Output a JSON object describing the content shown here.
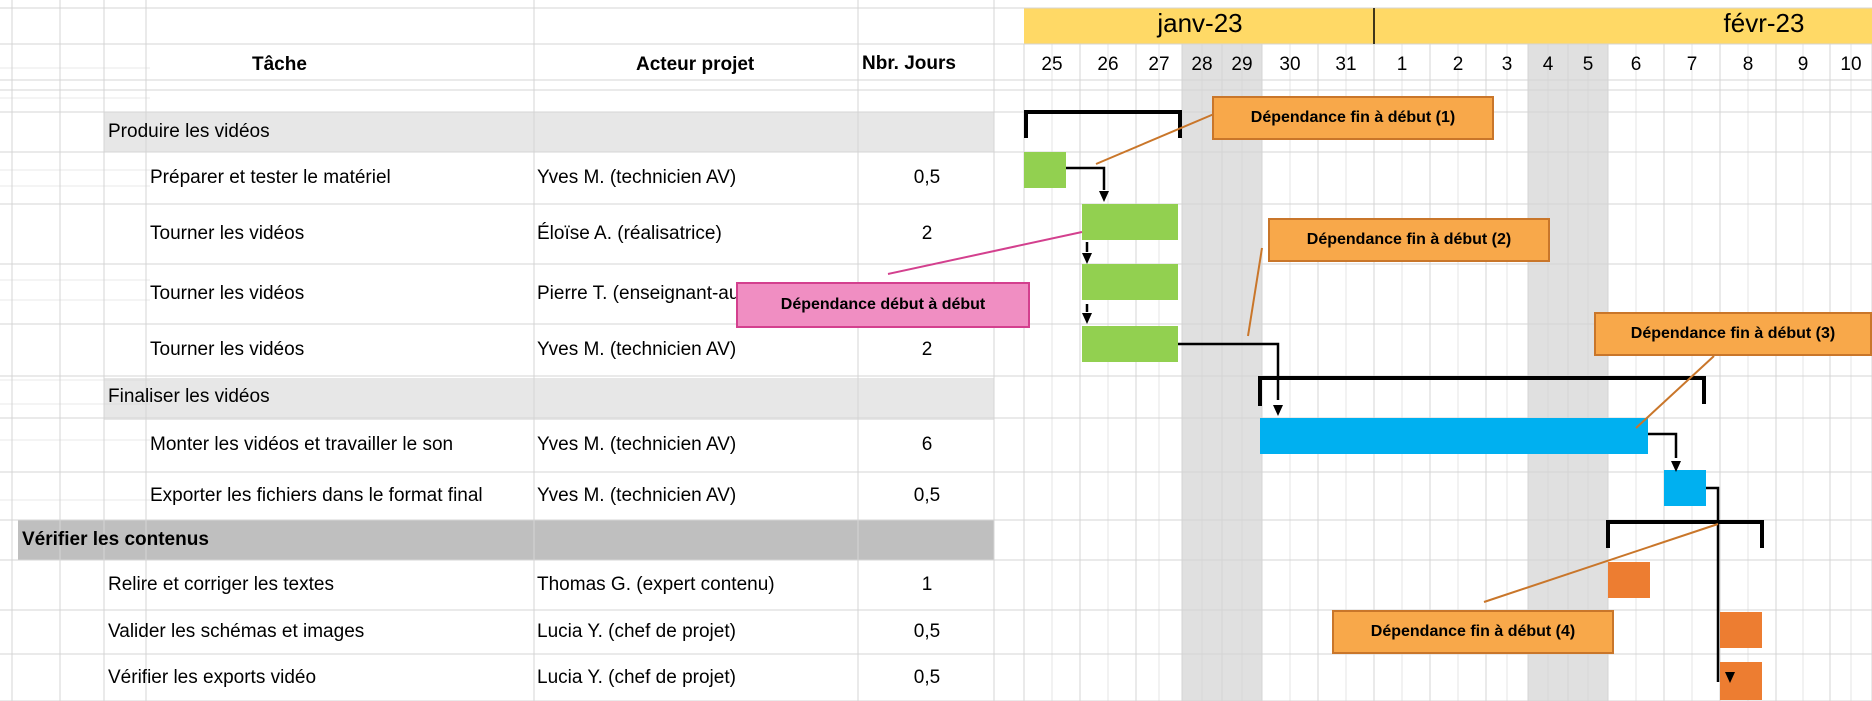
{
  "colors": {
    "month_header": "#ffd966",
    "group_band": "#e7e7e7",
    "section_band": "#bfbfbf",
    "weekend_shade": "#e0e0e0",
    "grid": "#d4d4d4",
    "green": "#92d050",
    "blue": "#00b0f0",
    "orange": "#ed7d31",
    "orange_callout": "#f8a84a",
    "pink_callout": "#f08ec2"
  },
  "columns": {
    "task": "Tâche",
    "actor": "Acteur projet",
    "days": "Nbr. Jours"
  },
  "timeline": {
    "months": [
      "janv-23",
      "févr-23"
    ],
    "days": [
      "25",
      "26",
      "27",
      "28",
      "29",
      "30",
      "31",
      "1",
      "2",
      "3",
      "4",
      "5",
      "6",
      "7",
      "8",
      "9",
      "10"
    ]
  },
  "rows": [
    {
      "type": "group",
      "task": "Produire les vidéos",
      "actor": "",
      "days": ""
    },
    {
      "type": "task",
      "task": "Préparer et tester le matériel",
      "actor": "Yves M. (technicien AV)",
      "days": "0,5"
    },
    {
      "type": "task",
      "task": "Tourner les vidéos",
      "actor": "Éloïse A. (réalisatrice)",
      "days": "2"
    },
    {
      "type": "task",
      "task": "Tourner les vidéos",
      "actor": "Pierre T. (enseignant-auteur)",
      "days": "2"
    },
    {
      "type": "task",
      "task": "Tourner les vidéos",
      "actor": "Yves M. (technicien AV)",
      "days": "2"
    },
    {
      "type": "group",
      "task": "Finaliser les vidéos",
      "actor": "",
      "days": ""
    },
    {
      "type": "task",
      "task": "Monter les vidéos et travailler le son",
      "actor": "Yves M. (technicien AV)",
      "days": "6"
    },
    {
      "type": "task",
      "task": "Exporter les fichiers dans le format final",
      "actor": "Yves M. (technicien AV)",
      "days": "0,5"
    },
    {
      "type": "section",
      "task": "Vérifier les contenus",
      "actor": "",
      "days": ""
    },
    {
      "type": "task2",
      "task": "Relire et corriger les textes",
      "actor": "Thomas G. (expert contenu)",
      "days": "1"
    },
    {
      "type": "task2",
      "task": "Valider les schémas et images",
      "actor": "Lucia Y. (chef de projet)",
      "days": "0,5"
    },
    {
      "type": "task2",
      "task": "Vérifier les exports vidéo",
      "actor": "Lucia Y. (chef de projet)",
      "days": "0,5"
    }
  ],
  "callouts": [
    "Dépendance fin à début (1)",
    "Dépendance fin à début (2)",
    "Dépendance fin à début (3)",
    "Dépendance fin à début (4)",
    "Dépendance début à début"
  ]
}
